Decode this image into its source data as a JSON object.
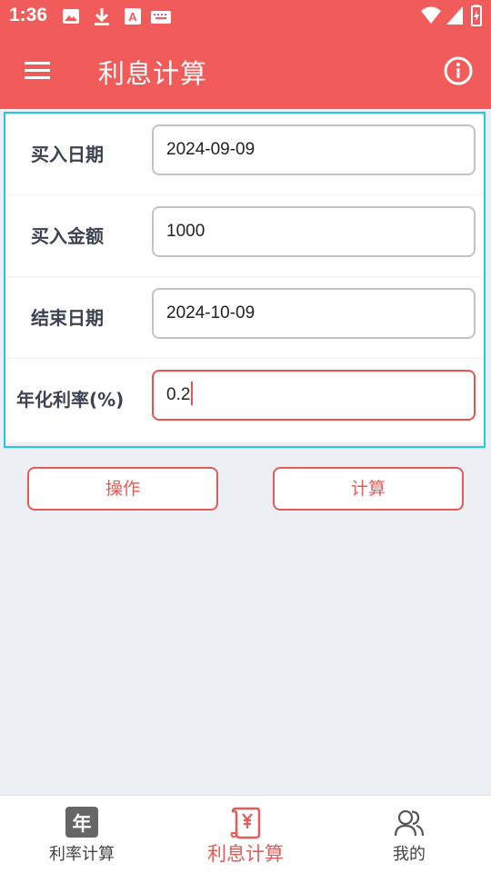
{
  "status_bar": {
    "time": "1:36",
    "icons": [
      "image-icon",
      "download-icon",
      "font-icon",
      "keyboard-icon",
      "wifi-icon",
      "signal-icon",
      "battery-icon"
    ]
  },
  "app_bar": {
    "title": "利息计算",
    "background": "#f15c5a"
  },
  "form": {
    "fields": [
      {
        "label": "买入日期",
        "value": "2024-09-09"
      },
      {
        "label": "买入金额",
        "value": "1000"
      },
      {
        "label": "结束日期",
        "value": "2024-10-09"
      },
      {
        "label": "年化利率(%)",
        "value": "0.2",
        "focused": true
      }
    ]
  },
  "actions": {
    "operate_label": "操作",
    "calculate_label": "计算"
  },
  "bottom_nav": {
    "items": [
      {
        "label": "利率计算",
        "icon": "year-calendar-icon",
        "badge": "年",
        "active": false
      },
      {
        "label": "利息计算",
        "icon": "scroll-yen-icon",
        "active": true
      },
      {
        "label": "我的",
        "icon": "users-icon",
        "active": false
      }
    ]
  },
  "colors": {
    "accent": "#f15c5a",
    "button_text": "#e65a58",
    "focus_outline": "#21c9e4"
  }
}
